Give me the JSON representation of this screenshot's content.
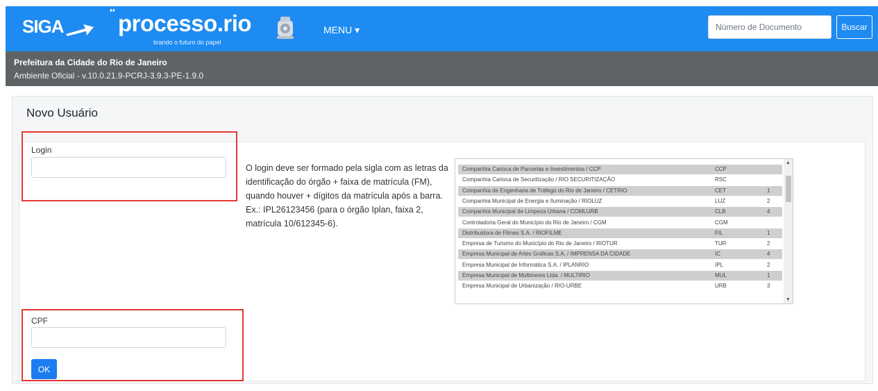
{
  "header": {
    "logo_siga": "SIGA",
    "logo_processo": "processo.rio",
    "logo_tagline": "tirando o futuro do papel",
    "menu_label": "MENU",
    "search_placeholder": "Número de Documento",
    "search_button": "Buscar",
    "brand_color": "#1d8bf1"
  },
  "environment": {
    "organization": "Prefeitura da Cidade do Rio de Janeiro",
    "version": "Ambiente Oficial - v.10.0.21.9-PCRJ-3.9.3-PE-1.9.0"
  },
  "form": {
    "title": "Novo Usuário",
    "login_label": "Login",
    "login_value": "",
    "cpf_label": "CPF",
    "cpf_value": "",
    "ok_button": "OK",
    "help_text": "O login deve ser formado pela sigla com as letras da identificação do órgão + faixa de matrícula (FM), quando houver + dígitos da matrícula após a barra. Ex.: IPL26123456 (para o órgão Iplan, faixa 2, matrícula 10/612345-6)."
  },
  "org_list": [
    {
      "name": "Companhia Carioca de Parcerias e Investimentos / CCP",
      "sigla": "CCP",
      "faixa": ""
    },
    {
      "name": "Companhia Carioca de Securitização / RIO SECURITIZAÇÃO",
      "sigla": "RSC",
      "faixa": ""
    },
    {
      "name": "Companhia de Engenharia de Tráfego do Rio de Janeiro / CETRIO",
      "sigla": "CET",
      "faixa": "1"
    },
    {
      "name": "Companhia Municipal de Energia e Iluminação / RIOLUZ",
      "sigla": "LUZ",
      "faixa": "2"
    },
    {
      "name": "Companhia Municipal de Limpeza Urbana / COMLURB",
      "sigla": "CLB",
      "faixa": "4"
    },
    {
      "name": "Controladoria Geral do Município do Rio de Janeiro / CGM",
      "sigla": "CGM",
      "faixa": ""
    },
    {
      "name": "Distribuidora de Filmes S.A. / RIOFILME",
      "sigla": "FIL",
      "faixa": "1"
    },
    {
      "name": "Empresa de Turismo do Município do Rio de Janeiro / RIOTUR",
      "sigla": "TUR",
      "faixa": "2"
    },
    {
      "name": "Empresa Municipal de Artes Gráficas S.A. / IMPRENSA DA CIDADE",
      "sigla": "IC",
      "faixa": "4"
    },
    {
      "name": "Empresa Municipal de Informática S.A. / IPLANRIO",
      "sigla": "IPL",
      "faixa": "2"
    },
    {
      "name": "Empresa Municipal de Multimeios Ltda. / MULTIRIO",
      "sigla": "MUL",
      "faixa": "1"
    },
    {
      "name": "Empresa Municipal de Urbanização / RIO-URBE",
      "sigla": "URB",
      "faixa": "3"
    }
  ],
  "highlight_color": "#e53935"
}
